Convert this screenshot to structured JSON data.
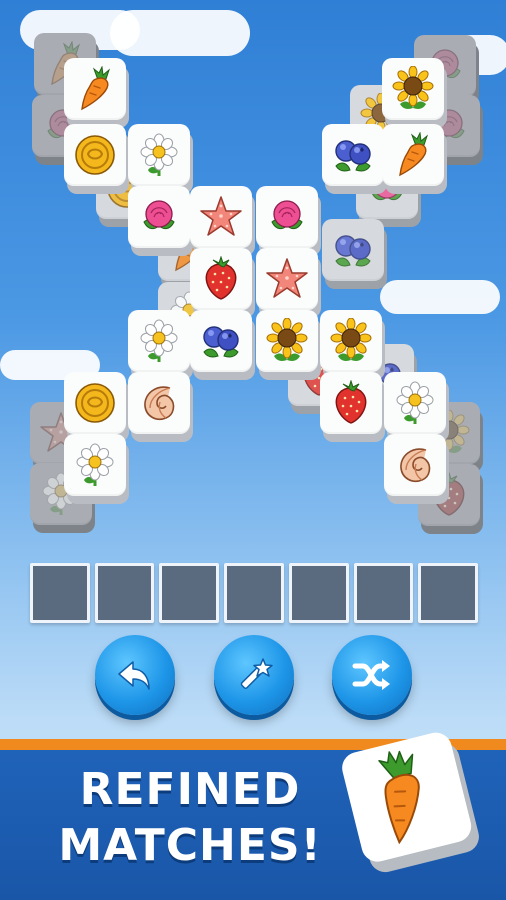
{
  "game": {
    "sky_colors": {
      "top": "#2f7fd6",
      "bottom": "#d5e9fa"
    },
    "tiles": [
      {
        "kind": "carrot",
        "layer": 0
      },
      {
        "kind": "rose",
        "layer": 0
      },
      {
        "kind": "rose",
        "layer": 0
      },
      {
        "kind": "rose",
        "layer": 0
      },
      {
        "kind": "starfish",
        "layer": 0
      },
      {
        "kind": "daisy",
        "layer": 0
      },
      {
        "kind": "sunflower",
        "layer": 0
      },
      {
        "kind": "strawberry",
        "layer": 0
      },
      {
        "kind": "coin",
        "layer": 1
      },
      {
        "kind": "carrot",
        "layer": 1
      },
      {
        "kind": "blueberry",
        "layer": 1
      },
      {
        "kind": "sunflower",
        "layer": 1
      },
      {
        "kind": "rose",
        "layer": 1
      },
      {
        "kind": "daisy",
        "layer": 1
      },
      {
        "kind": "strawberry",
        "layer": 1
      },
      {
        "kind": "blueberry",
        "layer": 1
      },
      {
        "kind": "carrot",
        "layer": 2
      },
      {
        "kind": "sunflower",
        "layer": 2
      },
      {
        "kind": "coin",
        "layer": 2
      },
      {
        "kind": "daisy",
        "layer": 2
      },
      {
        "kind": "blueberry",
        "layer": 2
      },
      {
        "kind": "carrot",
        "layer": 2
      },
      {
        "kind": "rose",
        "layer": 2
      },
      {
        "kind": "starfish",
        "layer": 2
      },
      {
        "kind": "rose",
        "layer": 2
      },
      {
        "kind": "strawberry",
        "layer": 2
      },
      {
        "kind": "starfish",
        "layer": 2
      },
      {
        "kind": "daisy",
        "layer": 2
      },
      {
        "kind": "blueberry",
        "layer": 2
      },
      {
        "kind": "sunflower",
        "layer": 2
      },
      {
        "kind": "sunflower",
        "layer": 2
      },
      {
        "kind": "coin",
        "layer": 2
      },
      {
        "kind": "shell",
        "layer": 2
      },
      {
        "kind": "strawberry",
        "layer": 2
      },
      {
        "kind": "daisy",
        "layer": 2
      },
      {
        "kind": "daisy",
        "layer": 2
      },
      {
        "kind": "shell",
        "layer": 2
      }
    ],
    "slots": [
      {
        "state": "empty"
      },
      {
        "state": "empty"
      },
      {
        "state": "empty"
      },
      {
        "state": "empty"
      },
      {
        "state": "empty"
      },
      {
        "state": "empty"
      },
      {
        "state": "empty"
      }
    ],
    "buttons": [
      {
        "name": "undo-button",
        "icon": "undo-arrow-icon"
      },
      {
        "name": "magic-wand-button",
        "icon": "magic-wand-icon"
      },
      {
        "name": "shuffle-button",
        "icon": "shuffle-icon"
      }
    ]
  },
  "banner": {
    "line1": "REFINED",
    "line2": "MATCHES!",
    "promo_icon": "carrot-tile-icon",
    "stripe_color": "#f08a1e",
    "bg_color": "#1f63b9"
  }
}
